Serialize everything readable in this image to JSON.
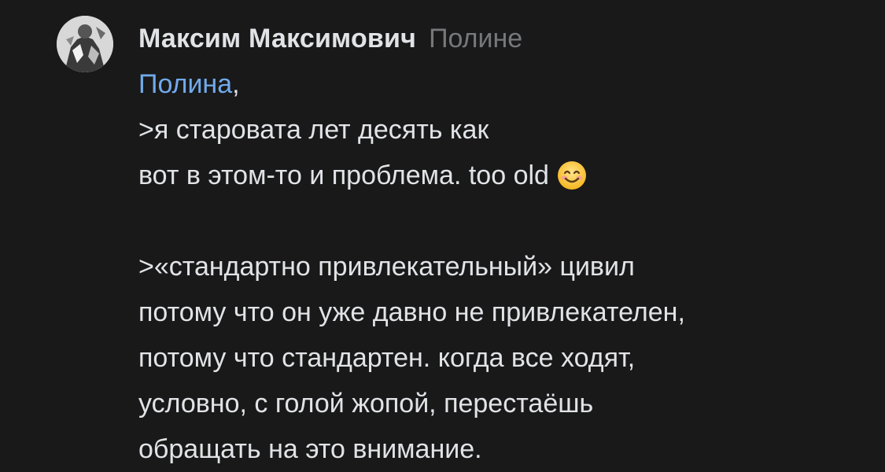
{
  "comment": {
    "author": "Максим Максимович",
    "reply_to": "Полине",
    "mention": "Полина",
    "mention_suffix": ",",
    "lines": [
      ">я староватa лет десять как",
      "вот в этом-то и проблема. too old",
      "",
      ">«стандартно привлекательный» цивил",
      "потому что он уже давно не привлекателен,",
      "потому что стандартен. когда все ходят,",
      "условно, с голой жопой, перестаёшь",
      "обращать на это внимание."
    ],
    "emoji": "smiling-face-emoji",
    "avatar_icon": "user-avatar-image"
  },
  "colors": {
    "background": "#19191a",
    "text": "#e1e3e6",
    "secondary": "#76787a",
    "link": "#71aaeb"
  }
}
